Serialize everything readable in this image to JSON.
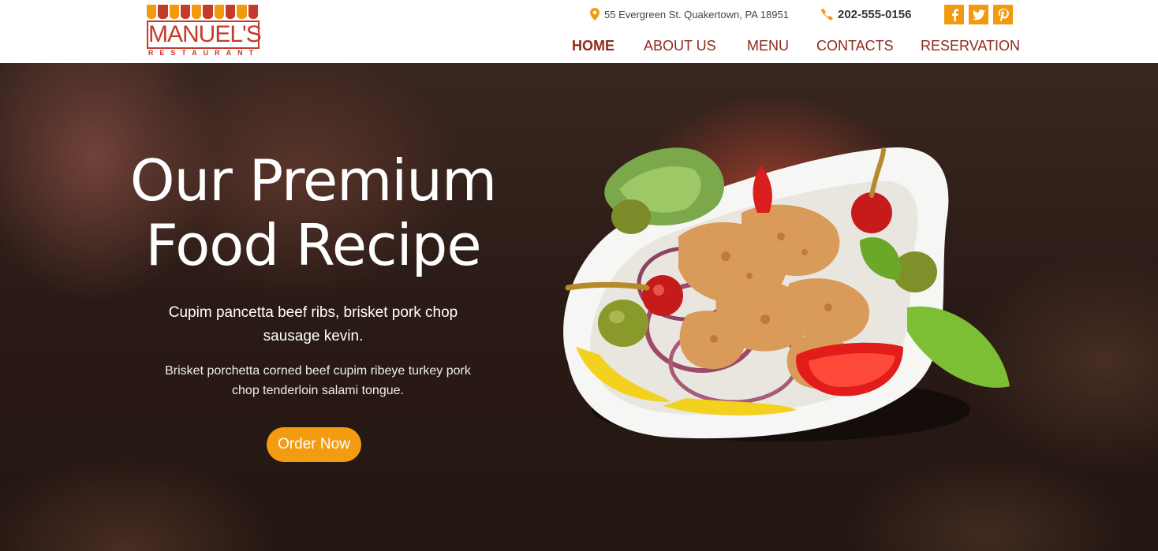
{
  "brand": {
    "name": "MANUEL'S",
    "tagline": "RESTAURANT",
    "awning_colors": [
      "#f19a0f",
      "#c43b2b"
    ]
  },
  "contact": {
    "address": "55 Evergreen St. Quakertown, PA 18951",
    "phone": "202-555-0156"
  },
  "socials": [
    {
      "icon": "facebook-icon",
      "glyph": "f"
    },
    {
      "icon": "twitter-icon",
      "glyph": "t"
    },
    {
      "icon": "pinterest-icon",
      "glyph": "p"
    }
  ],
  "nav": {
    "items": [
      {
        "label": "HOME",
        "active": true
      },
      {
        "label": "ABOUT US",
        "active": false
      },
      {
        "label": "MENU",
        "active": false
      },
      {
        "label": "CONTACTS",
        "active": false
      },
      {
        "label": "RESERVATION",
        "active": false
      }
    ]
  },
  "hero": {
    "title_line1": "Our Premium",
    "title_line2": "Food Recipe",
    "subtitle": "Cupim pancetta beef ribs, brisket pork chop sausage kevin.",
    "description": "Brisket porchetta corned beef cupim ribeye turkey pork chop tenderloin salami tongue.",
    "cta": "Order Now"
  },
  "colors": {
    "accent": "#f39c12",
    "nav_text": "#8f2a1c",
    "brand_red": "#c43b2b"
  }
}
